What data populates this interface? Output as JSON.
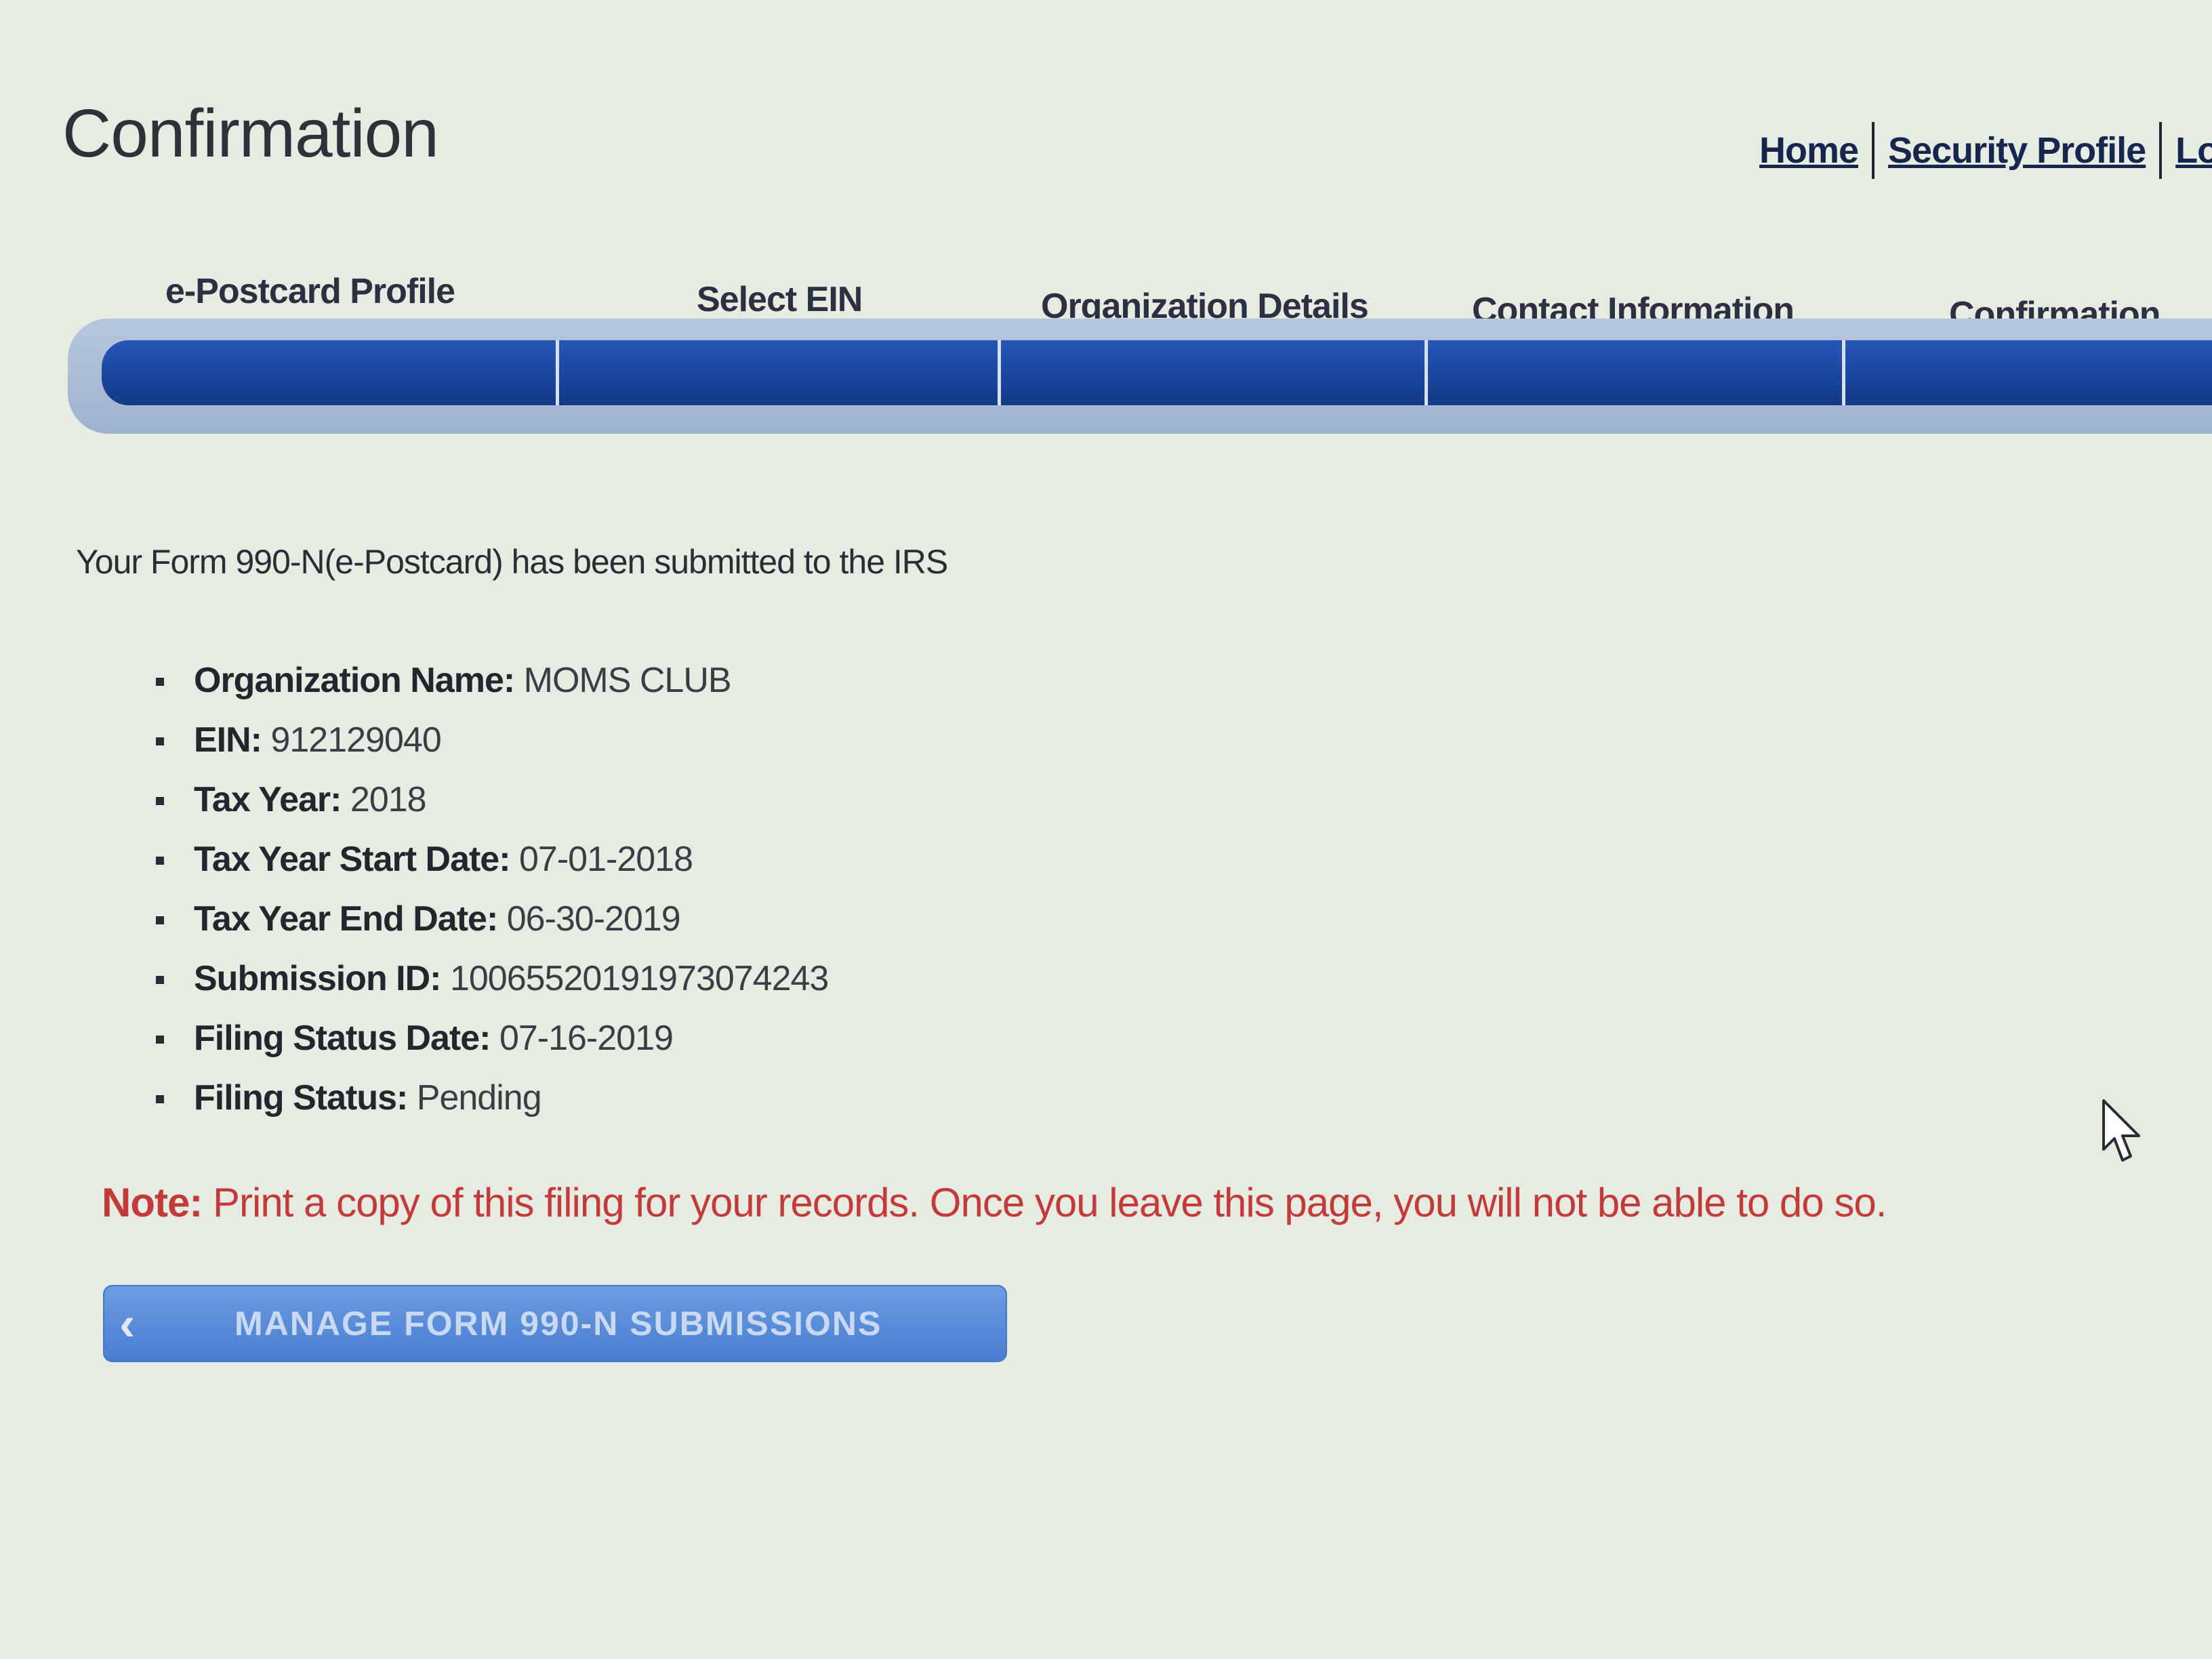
{
  "page": {
    "title": "Confirmation"
  },
  "top_links": {
    "home": "Home",
    "security_profile": "Security Profile",
    "logout": "Log"
  },
  "steps": [
    {
      "label": "e-Postcard Profile"
    },
    {
      "label": "Select EIN"
    },
    {
      "label": "Organization Details"
    },
    {
      "label": "Contact Information"
    },
    {
      "label": "Confirmation"
    }
  ],
  "intro": "Your Form 990-N(e-Postcard) has been submitted to the IRS",
  "details": [
    {
      "label": "Organization Name:",
      "value": "MOMS CLUB"
    },
    {
      "label": "EIN:",
      "value": "912129040"
    },
    {
      "label": "Tax Year:",
      "value": "2018"
    },
    {
      "label": "Tax Year Start Date:",
      "value": "07-01-2018"
    },
    {
      "label": "Tax Year End Date:",
      "value": "06-30-2019"
    },
    {
      "label": "Submission ID:",
      "value": "10065520191973074243"
    },
    {
      "label": "Filing Status Date:",
      "value": "07-16-2019"
    },
    {
      "label": "Filing Status:",
      "value": "Pending"
    }
  ],
  "note": {
    "label": "Note:",
    "text": "Print a copy of this filing for your records. Once you leave this page, you will not be able to do so."
  },
  "manage_button": {
    "icon": "chevron-left-icon",
    "label": "MANAGE FORM 990-N SUBMISSIONS"
  },
  "colors": {
    "background": "#e7ece3",
    "progress_bar": "#19449a",
    "note_text": "#c43a3a",
    "button": "#5a8bd8",
    "link": "#16264e"
  }
}
